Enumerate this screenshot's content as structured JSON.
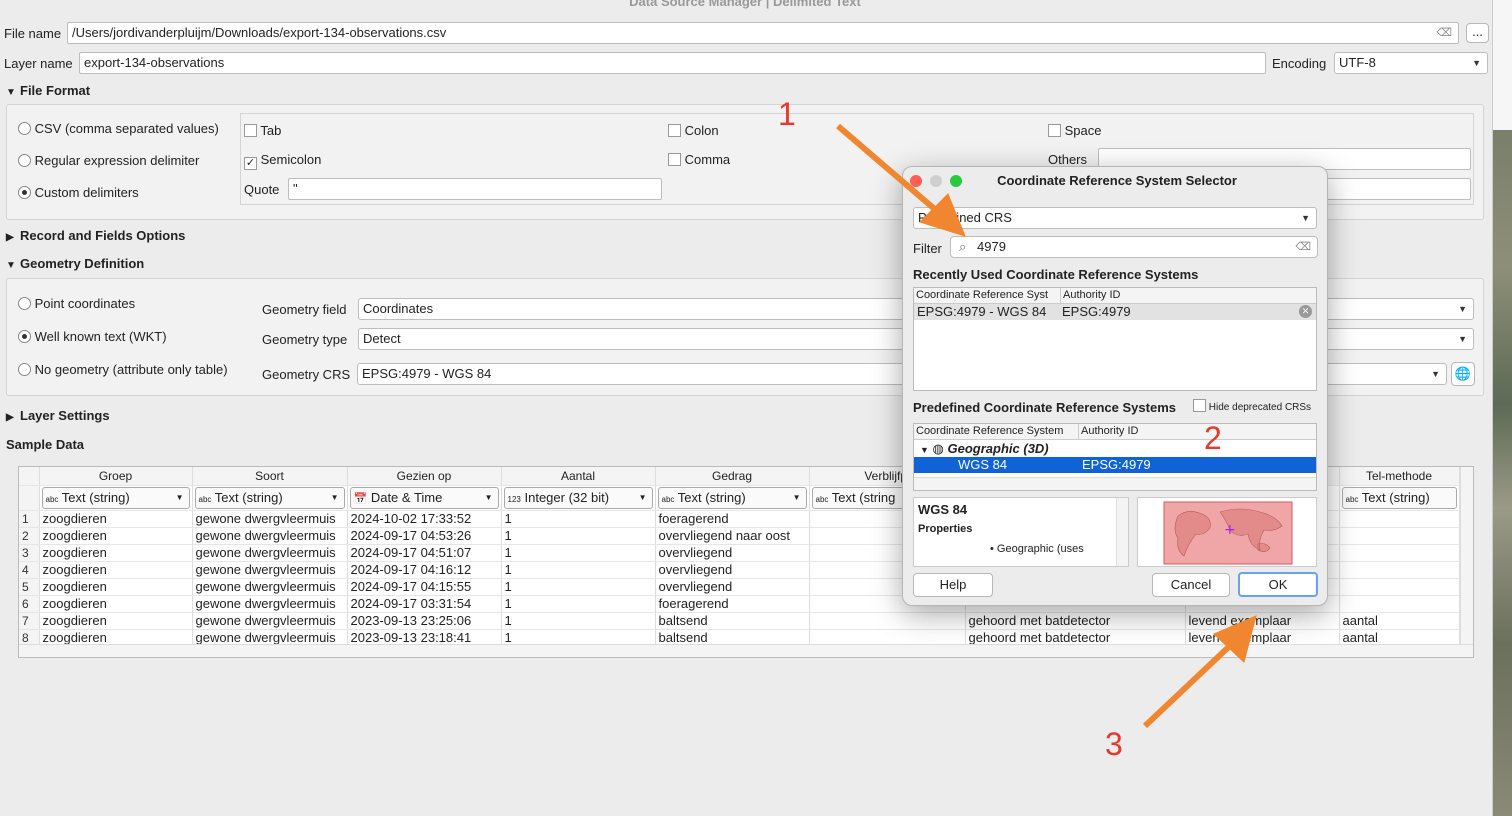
{
  "window": {
    "title": "Data Source Manager | Delimited Text"
  },
  "file": {
    "label": "File name",
    "value": "/Users/jordivanderpluijm/Downloads/export-134-observations.csv",
    "browse": "..."
  },
  "layer": {
    "label": "Layer name",
    "value": "export-134-observations",
    "encoding_label": "Encoding",
    "encoding_value": "UTF-8"
  },
  "file_format": {
    "title": "File Format",
    "radios": [
      "CSV (comma separated values)",
      "Regular expression delimiter",
      "Custom delimiters"
    ],
    "selected": "Custom delimiters",
    "delims": {
      "tab": "Tab",
      "colon": "Colon",
      "space": "Space",
      "semicolon": "Semicolon",
      "comma": "Comma",
      "others": "Others",
      "quote": "Quote",
      "quote_value": "\""
    },
    "semicolon_checked": "✓"
  },
  "record_fields": {
    "title": "Record and Fields Options"
  },
  "geometry": {
    "title": "Geometry Definition",
    "radios": [
      "Point coordinates",
      "Well known text (WKT)",
      "No geometry (attribute only table)"
    ],
    "selected": "Well known text (WKT)",
    "field_label": "Geometry field",
    "field_value": "Coordinates",
    "type_label": "Geometry type",
    "type_value": "Detect",
    "crs_label": "Geometry CRS",
    "crs_value": "EPSG:4979 - WGS 84"
  },
  "layer_settings": {
    "title": "Layer Settings"
  },
  "sample": {
    "title": "Sample Data",
    "columns": [
      "Groep",
      "Soort",
      "Gezien op",
      "Aantal",
      "Gedrag",
      "Verblijfpl",
      "",
      "",
      "Tel-methode"
    ],
    "types": [
      "Text (string)",
      "Text (string)",
      "Date & Time",
      "Integer (32 bit)",
      "Text (string)",
      "Text (string",
      "",
      "",
      "Text (string)"
    ],
    "type_prefix": [
      "abc",
      "abc",
      "",
      "123",
      "abc",
      "abc",
      "",
      "",
      "abc"
    ],
    "rows": [
      [
        "1",
        "zoogdieren",
        "gewone dwergvleermuis",
        "2024-10-02 17:33:52",
        "1",
        "foeragerend",
        "",
        "",
        "",
        ""
      ],
      [
        "2",
        "zoogdieren",
        "gewone dwergvleermuis",
        "2024-09-17 04:53:26",
        "1",
        "overvliegend naar oost",
        "",
        "",
        "",
        ""
      ],
      [
        "3",
        "zoogdieren",
        "gewone dwergvleermuis",
        "2024-09-17 04:51:07",
        "1",
        "overvliegend",
        "",
        "",
        "",
        ""
      ],
      [
        "4",
        "zoogdieren",
        "gewone dwergvleermuis",
        "2024-09-17 04:16:12",
        "1",
        "overvliegend",
        "",
        "",
        "",
        ""
      ],
      [
        "5",
        "zoogdieren",
        "gewone dwergvleermuis",
        "2024-09-17 04:15:55",
        "1",
        "overvliegend",
        "",
        "",
        "",
        ""
      ],
      [
        "6",
        "zoogdieren",
        "gewone dwergvleermuis",
        "2024-09-17 03:31:54",
        "1",
        "foeragerend",
        "",
        "",
        "",
        ""
      ],
      [
        "7",
        "zoogdieren",
        "gewone dwergvleermuis",
        "2023-09-13 23:25:06",
        "1",
        "baltsend",
        "",
        "gehoord met batdetector",
        "levend exemplaar",
        "aantal"
      ],
      [
        "8",
        "zoogdieren",
        "gewone dwergvleermuis",
        "2023-09-13 23:18:41",
        "1",
        "baltsend",
        "",
        "gehoord met batdetector",
        "levend exemplaar",
        "aantal"
      ]
    ]
  },
  "crs_dialog": {
    "title": "Coordinate Reference System Selector",
    "mode": "Predefined CRS",
    "filter_label": "Filter",
    "filter_value": "4979",
    "recent_title": "Recently Used Coordinate Reference Systems",
    "recent_cols": [
      "Coordinate Reference Syst",
      "Authority ID"
    ],
    "recent_rows": [
      [
        "EPSG:4979 - WGS 84",
        "EPSG:4979"
      ]
    ],
    "predef_title": "Predefined Coordinate Reference Systems",
    "hide_deprecated": "Hide deprecated CRSs",
    "predef_cols": [
      "Coordinate Reference System",
      "Authority ID"
    ],
    "group": "Geographic (3D)",
    "selected_row": [
      "WGS 84",
      "EPSG:4979"
    ],
    "info_title": "WGS 84",
    "info_props": "Properties",
    "info_bullet": "• Geographic (uses",
    "help": "Help",
    "cancel": "Cancel",
    "ok": "OK"
  },
  "annotations": [
    "1",
    "2",
    "3"
  ],
  "colors": {
    "arrow": "#f0862f",
    "annot_text": "#e8372b",
    "selection": "#0f63d6"
  }
}
